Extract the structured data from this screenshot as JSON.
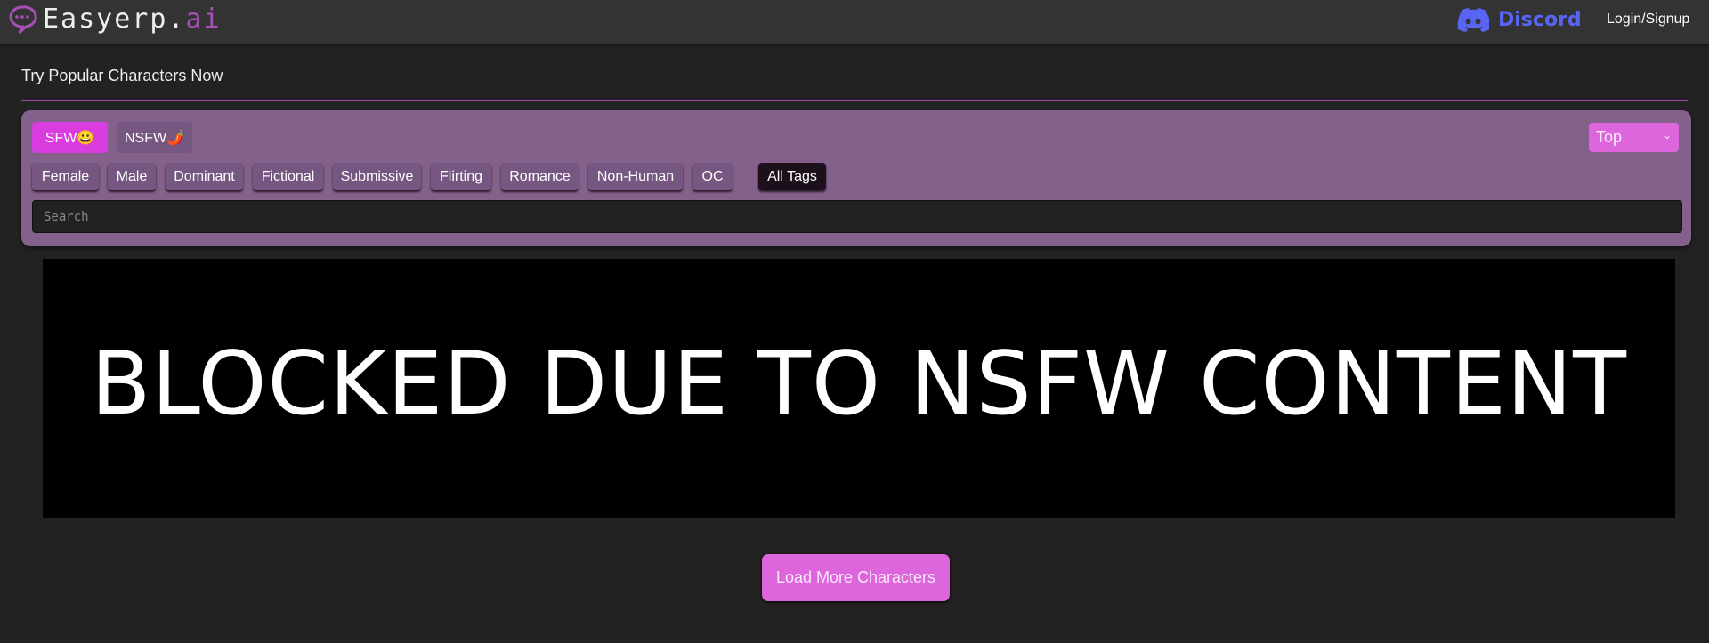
{
  "header": {
    "logo_main": "Easyerp.",
    "logo_accent": "ai",
    "discord_label": "Discord",
    "login_label": "Login/Signup"
  },
  "main": {
    "title": "Try Popular Characters Now"
  },
  "filters": {
    "sfw_label": "SFW😀",
    "nsfw_label": "NSFW🌶️",
    "sort_selected": "Top",
    "tags": [
      "Female",
      "Male",
      "Dominant",
      "Fictional",
      "Submissive",
      "Flirting",
      "Romance",
      "Non-Human",
      "OC",
      "All Tags"
    ],
    "search_placeholder": "Search"
  },
  "content": {
    "blocked_text": "BLOCKED DUE TO NSFW CONTENT"
  },
  "load_more_label": "Load More Characters",
  "colors": {
    "accent": "#dd66dd",
    "panel": "#84618a",
    "discord": "#5865f2"
  }
}
